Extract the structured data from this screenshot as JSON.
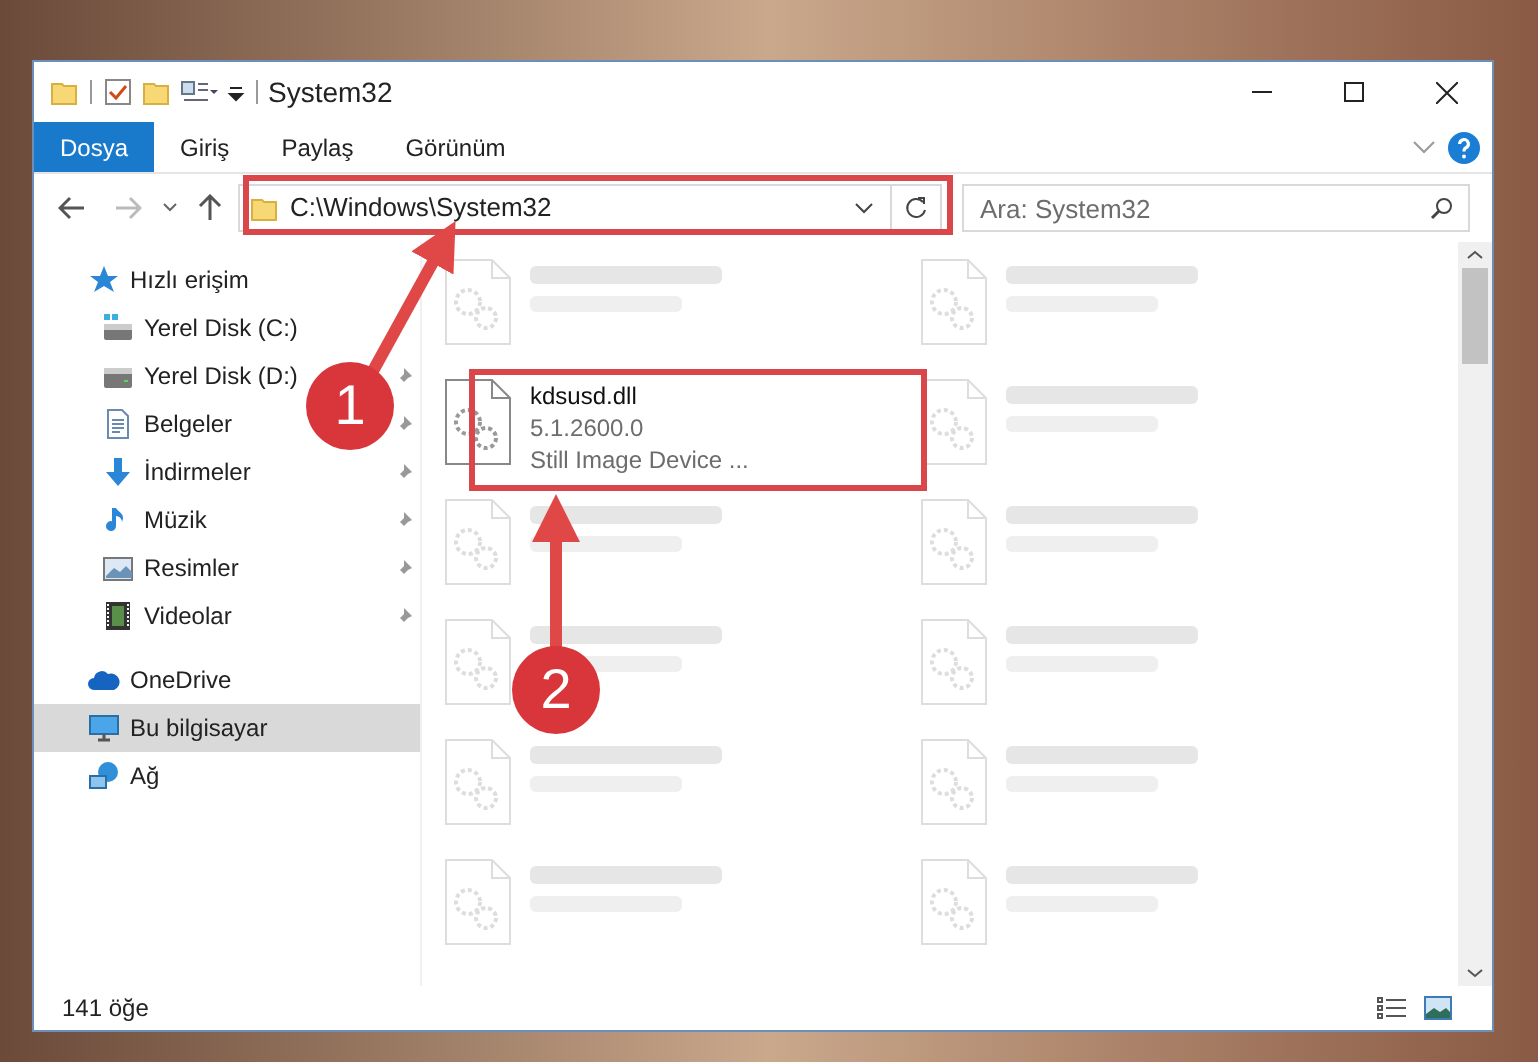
{
  "window": {
    "title": "System32"
  },
  "ribbon_tabs": [
    {
      "label": "Dosya",
      "selected": true
    },
    {
      "label": "Giriş",
      "selected": false
    },
    {
      "label": "Paylaş",
      "selected": false
    },
    {
      "label": "Görünüm",
      "selected": false
    }
  ],
  "address_bar": {
    "path": "C:\\Windows\\System32"
  },
  "search": {
    "placeholder": "Ara: System32"
  },
  "navigation": [
    {
      "label": "Hızlı erişim",
      "kind": "star",
      "selected": false,
      "children": [
        {
          "label": "Yerel Disk (C:)",
          "kind": "system-drive",
          "selected": false,
          "pinned": false
        },
        {
          "label": "Yerel Disk (D:)",
          "kind": "drive",
          "selected": false,
          "pinned": true
        },
        {
          "label": "Belgeler",
          "kind": "documents",
          "selected": false,
          "pinned": true
        },
        {
          "label": "İndirmeler",
          "kind": "download",
          "selected": false,
          "pinned": true
        },
        {
          "label": "Müzik",
          "kind": "music",
          "selected": false,
          "pinned": true
        },
        {
          "label": "Resimler",
          "kind": "pictures",
          "selected": false,
          "pinned": true
        },
        {
          "label": "Videolar",
          "kind": "videos",
          "selected": false,
          "pinned": true
        }
      ]
    },
    {
      "label": "OneDrive",
      "kind": "cloud",
      "selected": false
    },
    {
      "label": "Bu bilgisayar",
      "kind": "computer",
      "selected": true
    },
    {
      "label": "Ağ",
      "kind": "network",
      "selected": false
    }
  ],
  "files": [
    {
      "blurred": true
    },
    {
      "blurred": true
    },
    {
      "name": "kdsusd.dll",
      "details": [
        "5.1.2600.0",
        "Still Image Device ..."
      ],
      "blurred": false
    },
    {
      "blurred": true
    },
    {
      "blurred": true
    },
    {
      "blurred": true
    },
    {
      "blurred": true
    },
    {
      "blurred": true
    },
    {
      "blurred": true
    },
    {
      "blurred": true
    },
    {
      "blurred": true
    },
    {
      "blurred": true
    }
  ],
  "annotations": [
    {
      "label": "1"
    },
    {
      "label": "2"
    }
  ],
  "status_bar": {
    "item_count": "141 öğe"
  }
}
